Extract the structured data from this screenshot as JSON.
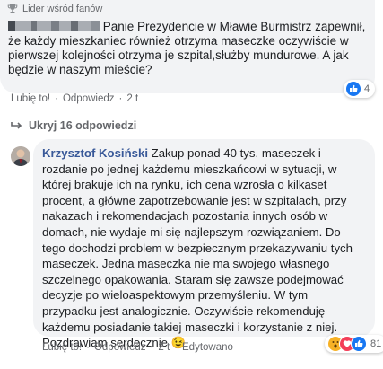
{
  "comment1": {
    "badge": "Lider wśród fanów",
    "text_after_redaction": "Panie Prezydencie w Mławie Burmistrz zapewnił, że każdy mieszkaniec również otrzyma maseczke oczywiście w pierwszej kolejności otrzyma je szpital,służby mundurowe. A jak będzie w naszym mieście?",
    "like_label": "Lubię to!",
    "reply_label": "Odpowiedz",
    "time": "2 t",
    "reaction_count": "4"
  },
  "replies_toggle": {
    "label": "Ukryj 16 odpowiedzi"
  },
  "comment2": {
    "author": "Krzysztof Kosiński",
    "text": "Zakup ponad 40 tys. maseczek i rozdanie po jednej każdemu mieszkańcowi w sytuacji, w której brakuje ich na rynku, ich cena wzrosła o kilkaset procent, a główne zapotrzebowanie jest w szpitalach, przy nakazach i rekomendacjach pozostania innych osób w domach, nie wydaje mi się najlepszym rozwiązaniem. Do tego dochodzi problem w bezpiecznym przekazywaniu tych maseczek. Jedna maseczka nie ma swojego własnego szczelnego opakowania. Staram się zawsze podejmować decyzje po wieloaspektowym przemyśleniu. W tym przypadku jest analogicznie. Oczywiście rekomenduję każdemu posiadanie takiej maseczki i korzystanie z niej. Pozdrawiam serdecznie",
    "emoji": "😉",
    "like_label": "Lubię to!",
    "reply_label": "Odpowiedz",
    "time": "2 t",
    "edited_label": "Edytowano",
    "reaction_count": "81"
  },
  "colors": {
    "bubble": "#f2f3f5",
    "author": "#385898",
    "meta": "#65676b",
    "like": "#1877f2",
    "love": "#f33e58",
    "wow": "#f7b125"
  }
}
